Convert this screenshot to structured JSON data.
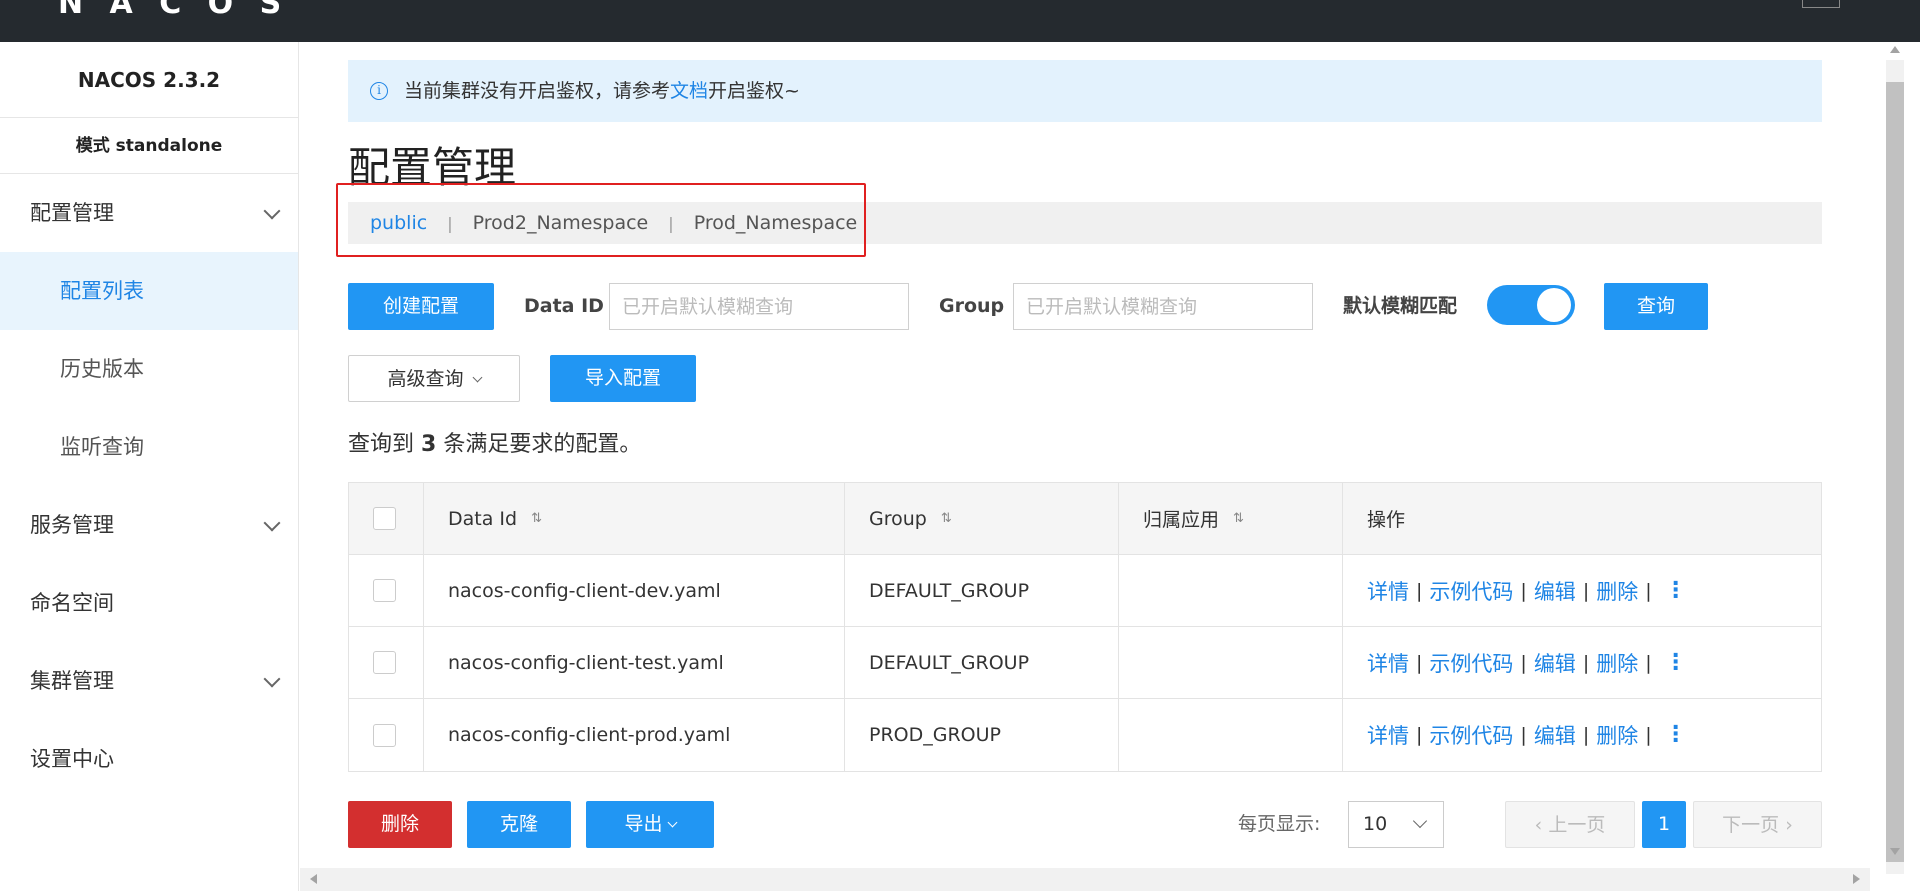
{
  "sidebar": {
    "title": "NACOS 2.3.2",
    "mode": "模式 standalone",
    "items": [
      {
        "label": "配置管理"
      },
      {
        "label": "配置列表"
      },
      {
        "label": "历史版本"
      },
      {
        "label": "监听查询"
      },
      {
        "label": "服务管理"
      },
      {
        "label": "命名空间"
      },
      {
        "label": "集群管理"
      },
      {
        "label": "设置中心"
      }
    ]
  },
  "notice": {
    "text_before": "当前集群没有开启鉴权，请参考",
    "link": "文档",
    "text_after": "开启鉴权~"
  },
  "page": {
    "title": "配置管理"
  },
  "namespaces": [
    {
      "label": "public",
      "active": true
    },
    {
      "label": "Prod2_Namespace",
      "active": false
    },
    {
      "label": "Prod_Namespace",
      "active": false
    }
  ],
  "namespace_separator": "|",
  "toolbar": {
    "create_label": "创建配置",
    "data_id_label": "Data ID",
    "data_id_placeholder": "已开启默认模糊查询",
    "group_label": "Group",
    "group_placeholder": "已开启默认模糊查询",
    "fuzzy_label": "默认模糊匹配",
    "fuzzy_on": true,
    "query_label": "查询",
    "advanced_label": "高级查询",
    "import_label": "导入配置"
  },
  "result": {
    "prefix": "查询到",
    "count": "3",
    "suffix": "条满足要求的配置。"
  },
  "table": {
    "columns": [
      "Data Id",
      "Group",
      "归属应用",
      "操作"
    ],
    "sort_icon": "sort-icon",
    "rows": [
      {
        "data_id": "nacos-config-client-dev.yaml",
        "group": "DEFAULT_GROUP",
        "app": ""
      },
      {
        "data_id": "nacos-config-client-test.yaml",
        "group": "DEFAULT_GROUP",
        "app": ""
      },
      {
        "data_id": "nacos-config-client-prod.yaml",
        "group": "PROD_GROUP",
        "app": ""
      }
    ],
    "actions": {
      "detail": "详情",
      "sample": "示例代码",
      "edit": "编辑",
      "delete": "删除",
      "sep": "|"
    }
  },
  "footer": {
    "delete_label": "删除",
    "clone_label": "克隆",
    "export_label": "导出",
    "page_size_label": "每页显示:",
    "page_size_value": "10",
    "prev_label": "上一页",
    "current_page": "1",
    "next_label": "下一页"
  },
  "colors": {
    "accent": "#2196f3",
    "link": "#1f85e5",
    "danger": "#d32f2f",
    "highlight_box": "#e02020"
  }
}
